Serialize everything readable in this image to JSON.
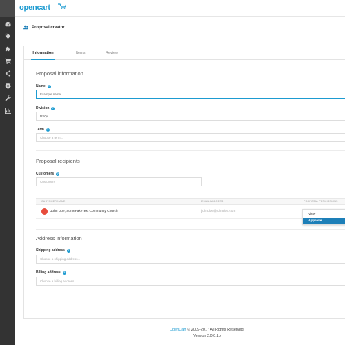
{
  "app": {
    "logo_text": "opencart"
  },
  "sidebar": {
    "items": [
      {
        "icon": "dashboard-icon"
      },
      {
        "icon": "tag-icon"
      },
      {
        "icon": "puzzle-icon"
      },
      {
        "icon": "shopping-cart-icon"
      },
      {
        "icon": "share-icon"
      },
      {
        "icon": "gear-icon"
      },
      {
        "icon": "wrench-icon"
      },
      {
        "icon": "bar-chart-icon"
      }
    ]
  },
  "page": {
    "title": "Proposal creator"
  },
  "tabs": [
    {
      "label": "Information",
      "active": true
    },
    {
      "label": "Items",
      "active": false
    },
    {
      "label": "Review",
      "active": false
    }
  ],
  "proposal_info": {
    "title": "Proposal information",
    "name_label": "Name",
    "name_value": "Example name",
    "division_label": "Division",
    "division_value": "DSQi",
    "term_label": "Term",
    "term_placeholder": "Choose a term..."
  },
  "recipients": {
    "title": "Proposal recipients",
    "customers_label": "Customers",
    "customers_placeholder": "Customers",
    "columns": [
      "Customer name",
      "Email address",
      "Proposal permissions"
    ],
    "rows": [
      {
        "name": "John Doe, SomeFakeText Community Church",
        "email": "johndoe@johndoe.com",
        "avatar_color": "#e74c3c"
      }
    ],
    "permission_options": [
      {
        "label": "View",
        "selected": false
      },
      {
        "label": "Approve",
        "selected": true
      }
    ]
  },
  "address": {
    "title": "Address information",
    "shipping_label": "Shipping address",
    "shipping_placeholder": "Choose a shipping address...",
    "billing_label": "Billing address",
    "billing_placeholder": "Choose a billing address..."
  },
  "footer": {
    "brand": "OpenCart",
    "copyright": "© 2009-2017 All Rights Reserved.",
    "version": "Version 2.0.0.1b"
  },
  "colors": {
    "accent": "#1d9bd1",
    "sidebar": "#333333",
    "selected": "#1d7fb8"
  }
}
